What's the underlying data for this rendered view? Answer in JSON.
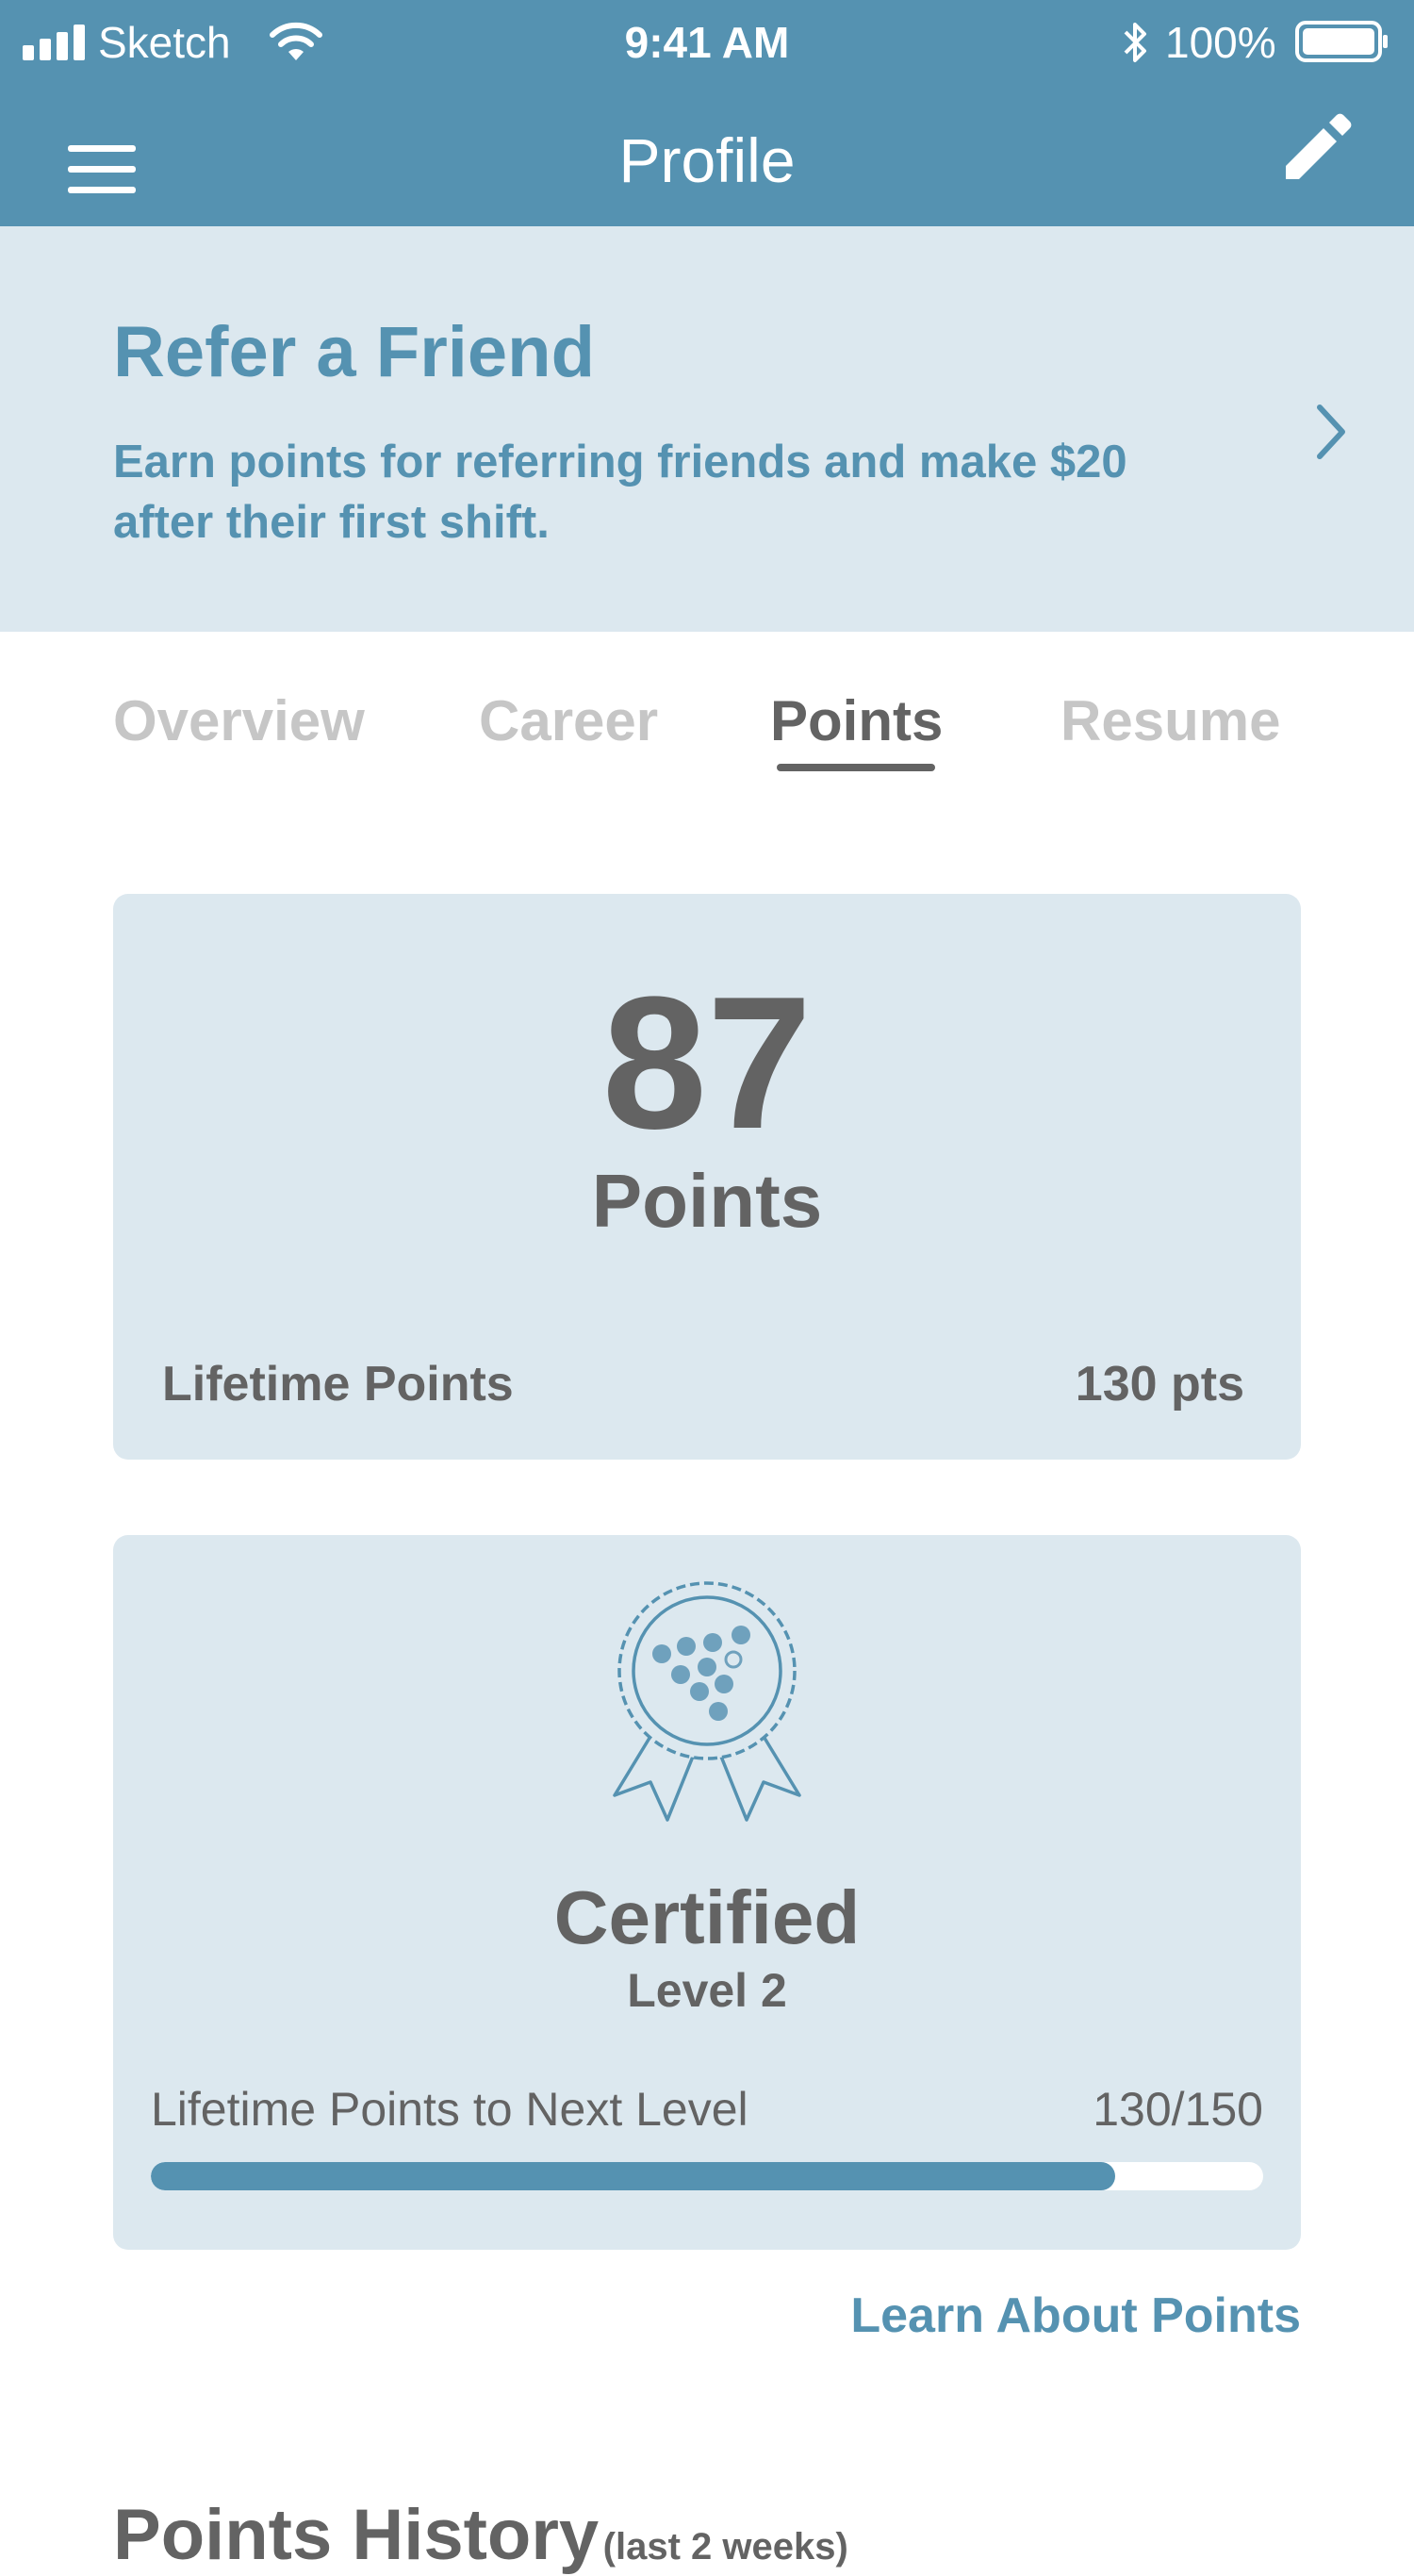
{
  "status_bar": {
    "carrier": "Sketch",
    "time": "9:41 AM",
    "battery": "100%"
  },
  "nav": {
    "title": "Profile",
    "menu_icon": "hamburger-menu-icon",
    "edit_icon": "pencil-icon"
  },
  "refer": {
    "title": "Refer a Friend",
    "description": "Earn points for referring friends and make $20 after their first shift.",
    "chevron_icon": "chevron-right-icon"
  },
  "tabs": [
    {
      "label": "Overview",
      "active": false
    },
    {
      "label": "Career",
      "active": false
    },
    {
      "label": "Points",
      "active": true
    },
    {
      "label": "Resume",
      "active": false
    }
  ],
  "points_card": {
    "points": "87",
    "points_label": "Points",
    "lifetime_label": "Lifetime Points",
    "lifetime_value": "130 pts"
  },
  "level_card": {
    "badge_icon": "award-ribbon-icon",
    "title": "Certified",
    "level": "Level 2",
    "progress_label": "Lifetime Points to Next Level",
    "progress_value": "130/150",
    "progress_fraction": 0.8667
  },
  "learn_link": "Learn About Points",
  "history": {
    "title": "Points History",
    "subtitle": "(last 2 weeks)"
  },
  "colors": {
    "brand": "#5592b1",
    "panel": "#dce8ef",
    "text": "#636363",
    "inactive_tab": "#c6c6c6"
  }
}
